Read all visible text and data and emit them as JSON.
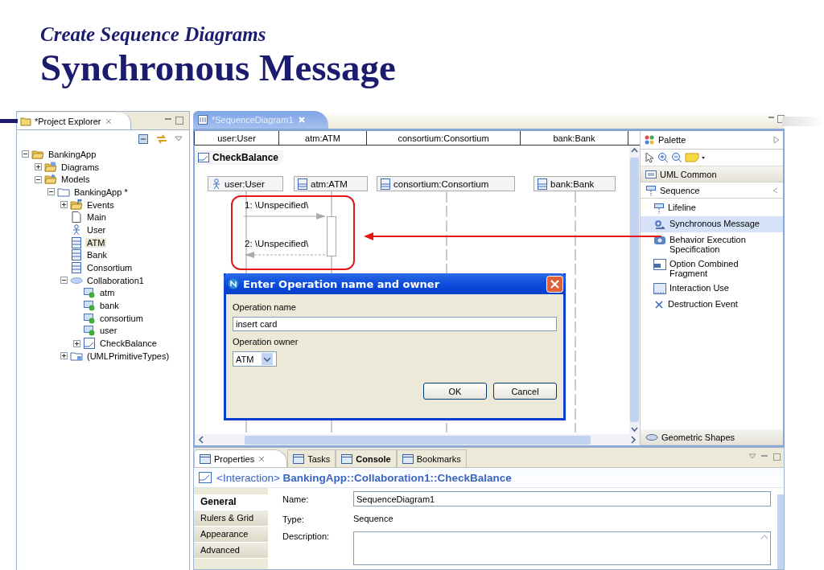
{
  "slide": {
    "subtitle": "Create Sequence Diagrams",
    "title": "Synchronous Message"
  },
  "project_explorer": {
    "title": "*Project Explorer",
    "tree": [
      {
        "label": "BankingApp",
        "kind": "folder",
        "expanded": true,
        "selected": false,
        "children": [
          {
            "label": "Diagrams",
            "kind": "diagrams-folder",
            "expanded": false,
            "selected": false
          },
          {
            "label": "Models",
            "kind": "models-folder",
            "expanded": true,
            "selected": false,
            "children": [
              {
                "label": "BankingApp *",
                "kind": "package",
                "expanded": true,
                "selected": false,
                "children": [
                  {
                    "label": "Events",
                    "kind": "events-folder",
                    "expanded": false,
                    "selected": false
                  },
                  {
                    "label": "Main",
                    "kind": "page",
                    "selected": false
                  },
                  {
                    "label": "User",
                    "kind": "actor",
                    "selected": false
                  },
                  {
                    "label": "ATM",
                    "kind": "class",
                    "selected": true
                  },
                  {
                    "label": "Bank",
                    "kind": "class",
                    "selected": false
                  },
                  {
                    "label": "Consortium",
                    "kind": "class",
                    "selected": false
                  },
                  {
                    "label": "Collaboration1",
                    "kind": "collaboration",
                    "expanded": true,
                    "selected": false,
                    "children": [
                      {
                        "label": "atm",
                        "kind": "part",
                        "selected": false
                      },
                      {
                        "label": "bank",
                        "kind": "part",
                        "selected": false
                      },
                      {
                        "label": "consortium",
                        "kind": "part",
                        "selected": false
                      },
                      {
                        "label": "user",
                        "kind": "part",
                        "selected": false
                      },
                      {
                        "label": "CheckBalance",
                        "kind": "interaction",
                        "expanded": false,
                        "selected": false
                      }
                    ]
                  },
                  {
                    "label": "(UMLPrimitiveTypes)",
                    "kind": "primitive-types",
                    "expanded": false,
                    "selected": false
                  }
                ]
              }
            ]
          }
        ]
      }
    ]
  },
  "editor": {
    "tab": {
      "label": "*SequenceDiagram1",
      "selected": true
    },
    "ruler": [
      "user:User",
      "atm:ATM",
      "consortium:Consortium",
      "bank:Bank"
    ],
    "frame_label": "CheckBalance",
    "lifelines": [
      {
        "name": "user:User",
        "kind": "actor"
      },
      {
        "name": "atm:ATM",
        "kind": "class"
      },
      {
        "name": "consortium:Consortium",
        "kind": "class"
      },
      {
        "name": "bank:Bank",
        "kind": "class"
      }
    ],
    "messages": [
      {
        "label": "1: \\Unspecified\\",
        "kind": "call"
      },
      {
        "label": "2: \\Unspecified\\",
        "kind": "reply"
      }
    ]
  },
  "dialog": {
    "title": "Enter Operation name and owner",
    "name_label": "Operation name",
    "name_value": "insert card",
    "owner_label": "Operation owner",
    "owner_value": "ATM",
    "buttons": [
      "OK",
      "Cancel"
    ]
  },
  "palette": {
    "title": "Palette",
    "drawers": [
      {
        "label": "UML Common",
        "kind": "common",
        "expanded": false
      },
      {
        "label": "Sequence",
        "kind": "sequence",
        "expanded": true,
        "items": [
          {
            "label": "Lifeline",
            "kind": "lifeline",
            "selected": false
          },
          {
            "label": "Synchronous Message",
            "kind": "message",
            "selected": true
          },
          {
            "label": "Behavior Execution Specification",
            "kind": "execution",
            "selected": false
          },
          {
            "label": "Option Combined Fragment",
            "kind": "fragment",
            "selected": false
          },
          {
            "label": "Interaction Use",
            "kind": "interaction-use",
            "selected": false
          },
          {
            "label": "Destruction Event",
            "kind": "destruction",
            "selected": false
          }
        ]
      },
      {
        "label": "Geometric Shapes",
        "kind": "shapes",
        "expanded": false
      }
    ]
  },
  "properties": {
    "tabs": [
      {
        "label": "Properties",
        "selected": true,
        "changed": false
      },
      {
        "label": "Tasks",
        "selected": false,
        "changed": false
      },
      {
        "label": "Console",
        "selected": false,
        "changed": true
      },
      {
        "label": "Bookmarks",
        "selected": false,
        "changed": false
      }
    ],
    "header_kind": "<Interaction>",
    "header_path": "BankingApp::Collaboration1::CheckBalance",
    "side_tabs": [
      {
        "label": "General",
        "selected": true
      },
      {
        "label": "Rulers & Grid",
        "selected": false
      },
      {
        "label": "Appearance",
        "selected": false
      },
      {
        "label": "Advanced",
        "selected": false
      }
    ],
    "name_label": "Name:",
    "name_value": "SequenceDiagram1",
    "type_label": "Type:",
    "type_value": "Sequence",
    "description_label": "Description:"
  }
}
